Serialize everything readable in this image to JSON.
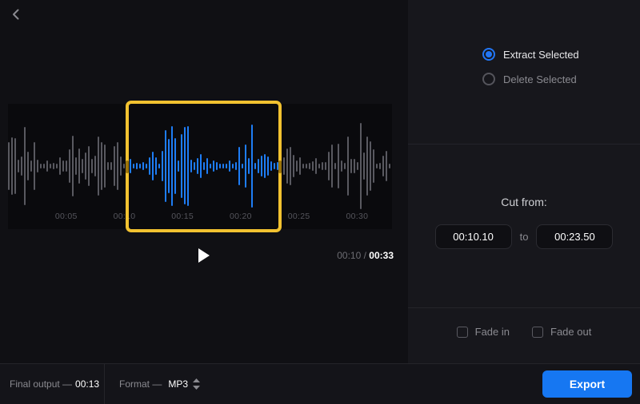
{
  "options": {
    "extract": {
      "label": "Extract Selected",
      "selected": true
    },
    "delete": {
      "label": "Delete Selected",
      "selected": false
    }
  },
  "cut": {
    "title": "Cut from:",
    "from": "00:10.10",
    "to_word": "to",
    "to": "00:23.50"
  },
  "fade": {
    "in_label": "Fade in",
    "out_label": "Fade out"
  },
  "player": {
    "current": "00:10",
    "sep": " / ",
    "total": "00:33",
    "tick_labels": [
      "00:05",
      "00:10",
      "00:15",
      "00:20",
      "00:25",
      "00:30"
    ]
  },
  "footer": {
    "final_label": "Final output —",
    "final_value": "00:13",
    "format_label": "Format —",
    "format_value": "MP3",
    "export_label": "Export"
  },
  "waveform": {
    "duration_sec": 33,
    "selection_start_sec": 10.1,
    "selection_end_sec": 23.5,
    "tick_seconds": [
      5,
      10,
      15,
      20,
      25,
      30
    ],
    "colors": {
      "selected": "#1e7df5",
      "unselected": "#595960",
      "selection_border": "#f2c230"
    }
  }
}
